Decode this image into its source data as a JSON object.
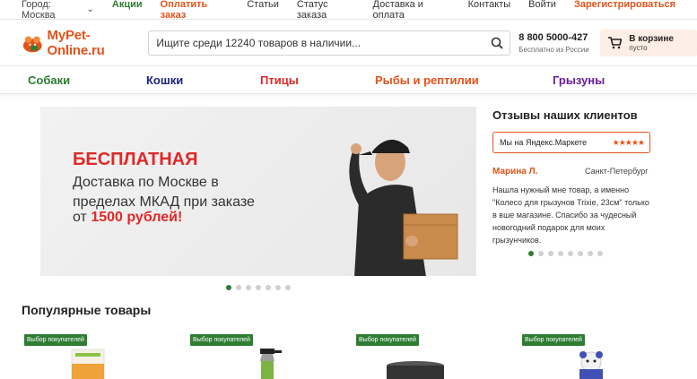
{
  "topbar": {
    "city_label": "Город: Москва",
    "links": [
      "Акции",
      "Оплатить заказ",
      "Статьи",
      "Статус заказа",
      "Доставка и оплата",
      "Контакты",
      "Войти",
      "Зарегистрироваться"
    ]
  },
  "header": {
    "logo_text": "MyPet-Online.ru",
    "search_placeholder": "Ищите среди 12240 товаров в наличии...",
    "phone": "8 800 5000-427",
    "phone_sub": "Бесплатно из России",
    "cart_title": "В корзине",
    "cart_sub": "пусто"
  },
  "categories": [
    {
      "label": "Собаки",
      "color": "#2e7d32"
    },
    {
      "label": "Кошки",
      "color": "#1a237e"
    },
    {
      "label": "Птицы",
      "color": "#e02828"
    },
    {
      "label": "Рыбы и рептилии",
      "color": "#e2531a"
    },
    {
      "label": "Грызуны",
      "color": "#6a1b9a"
    }
  ],
  "banner": {
    "line1": "БЕСПЛАТНАЯ",
    "line2": "Доставка по Москве в пределах МКАД при заказе",
    "line3_prefix": "от",
    "line3_amount": "1500 рублей!"
  },
  "reviews": {
    "title": "Отзывы наших клиентов",
    "market_label": "Мы на Яндекс.Маркете",
    "stars": "★★★★★",
    "name": "Марина Л.",
    "city": "Санкт-Петербург",
    "text": "Нашла нужный мне товар, а именно \"Колесо для грызунов Trixie, 23см\" только в вше магазине. Спасибо за чудесный новогодний подарок для моих грызунчиков."
  },
  "popular": {
    "title": "Популярные товары",
    "badge": "Выбор покупателей"
  },
  "colors": {
    "brand_orange": "#e2531a",
    "brand_green": "#2e7d32"
  }
}
